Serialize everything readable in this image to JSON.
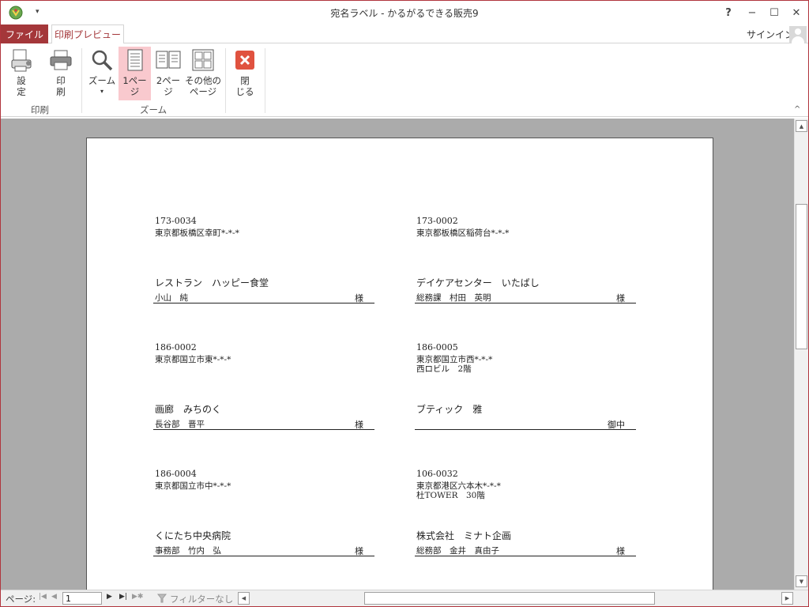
{
  "window": {
    "title": "宛名ラベル - かるがるできる販売9",
    "help": "?",
    "minimize": "−",
    "maximize": "☐",
    "close": "✕"
  },
  "tabs": {
    "file": "ファイル",
    "print_preview": "印刷プレビュー"
  },
  "account": {
    "signin": "サインイン"
  },
  "ribbon": {
    "settings_label": "設\n定",
    "print_label": "印\n刷",
    "zoom_label": "ズーム",
    "one_page_label": "1ペー\nジ",
    "two_pages_label": "2ペー\nジ",
    "more_pages_label": "その他の\nページ",
    "close_label": "閉\nじる",
    "group_print": "印刷",
    "group_zoom": "ズーム"
  },
  "labels": [
    {
      "zip": "173-0034",
      "addr1": "東京都板橋区幸町*-*-*",
      "addr2": "",
      "company": "レストラン　ハッピー食堂",
      "person": "小山　純",
      "suffix": "様"
    },
    {
      "zip": "173-0002",
      "addr1": "東京都板橋区稲荷台*-*-*",
      "addr2": "",
      "company": "デイケアセンター　いたばし",
      "person": "総務課　村田　英明",
      "suffix": "様"
    },
    {
      "zip": "186-0002",
      "addr1": "東京都国立市東*-*-*",
      "addr2": "",
      "company": "画廊　みちのく",
      "person": "長谷部　晋平",
      "suffix": "様"
    },
    {
      "zip": "186-0005",
      "addr1": "東京都国立市西*-*-*",
      "addr2": "西ロビル　2階",
      "company": "ブティック　雅",
      "person": "",
      "suffix": "御中"
    },
    {
      "zip": "186-0004",
      "addr1": "東京都国立市中*-*-*",
      "addr2": "",
      "company": "くにたち中央病院",
      "person": "事務部　竹内　弘",
      "suffix": "様"
    },
    {
      "zip": "106-0032",
      "addr1": "東京都港区六本木*-*-*",
      "addr2": "杜TOWER　30階",
      "company": "株式会社　ミナト企画",
      "person": "総務部　金井　真由子",
      "suffix": "様"
    }
  ],
  "status": {
    "page_label": "ページ:",
    "page_value": "1",
    "filter": "フィルターなし",
    "nav_first": "|◀",
    "nav_prev": "◀",
    "nav_next": "▶",
    "nav_last": "▶|",
    "nav_new": "▶✱"
  },
  "colors": {
    "accent": "#a4373a",
    "active_button": "#f9c9ce",
    "workspace": "#ababab"
  },
  "icons": [
    "app-icon",
    "page-setup-icon",
    "printer-icon",
    "magnifier-icon",
    "one-page-icon",
    "two-pages-icon",
    "more-pages-icon",
    "close-preview-icon",
    "filter-icon"
  ]
}
